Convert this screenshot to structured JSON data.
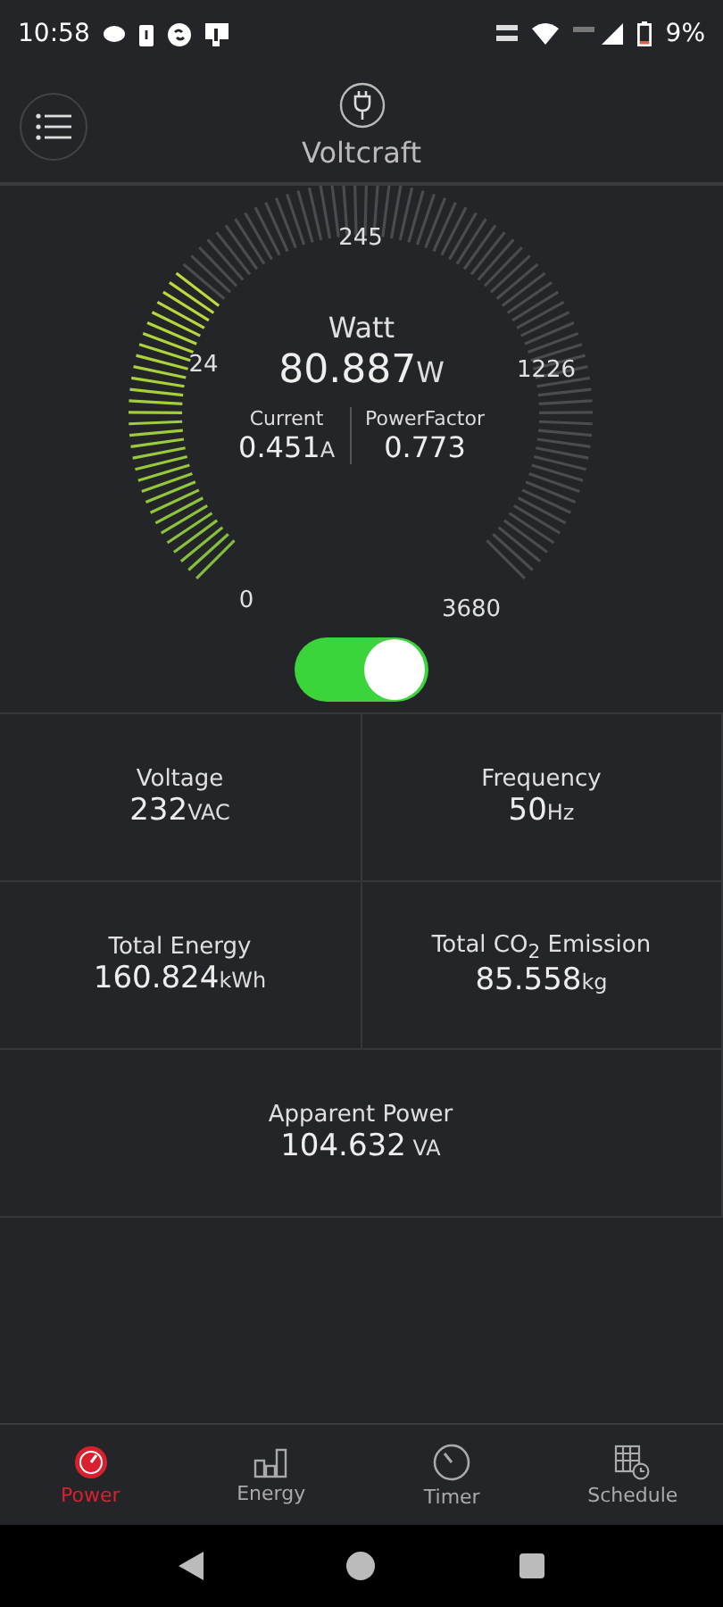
{
  "status_bar": {
    "time": "10:58",
    "battery": "9%"
  },
  "header": {
    "title": "Voltcraft"
  },
  "gauge": {
    "title": "Watt",
    "value": "80.887",
    "unit": "W",
    "scale_labels": [
      "0",
      "24",
      "245",
      "1226",
      "3680"
    ],
    "current": {
      "label": "Current",
      "value": "0.451",
      "unit": "A"
    },
    "power_factor": {
      "label": "PowerFactor",
      "value": "0.773"
    },
    "power_switch": {
      "on": true
    }
  },
  "metrics": [
    {
      "label": "Voltage",
      "value": "232",
      "unit": "VAC"
    },
    {
      "label": "Frequency",
      "value": "50",
      "unit": "Hz"
    },
    {
      "label": "Total Energy",
      "value": "160.824",
      "unit": "kWh"
    },
    {
      "label": "Total CO$_{2}$ Emission",
      "value": "85.558",
      "unit": "kg"
    },
    {
      "label": "Apparent Power",
      "value": "104.632",
      "unit": " VA"
    }
  ],
  "tabs": [
    {
      "label": "Power",
      "kind": "gauge",
      "selected": true
    },
    {
      "label": "Energy",
      "kind": "bars",
      "selected": false
    },
    {
      "label": "Timer",
      "kind": "timer",
      "selected": false
    },
    {
      "label": "Schedule",
      "kind": "calendar",
      "selected": false
    }
  ]
}
